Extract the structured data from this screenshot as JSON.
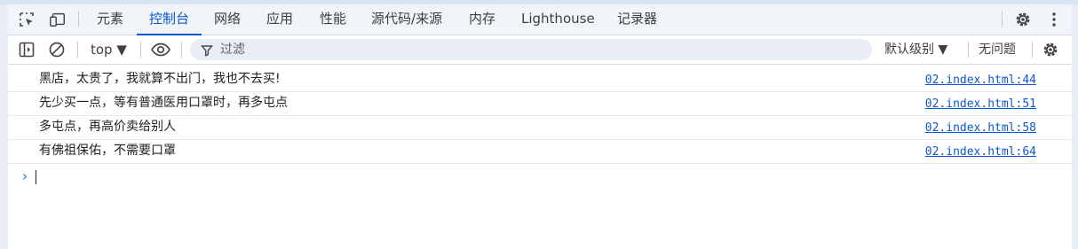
{
  "tabs": [
    {
      "label": "元素"
    },
    {
      "label": "控制台",
      "active": true
    },
    {
      "label": "网络"
    },
    {
      "label": "应用"
    },
    {
      "label": "性能"
    },
    {
      "label": "源代码/来源"
    },
    {
      "label": "内存"
    },
    {
      "label": "Lighthouse"
    },
    {
      "label": "记录器"
    }
  ],
  "toolbar": {
    "context": "top ▼",
    "filter_placeholder": "过滤",
    "levels": "默认级别 ▼",
    "issues": "无问题"
  },
  "messages": [
    {
      "text": "黑店，太贵了，我就算不出门，我也不去买!",
      "source": "02.index.html:44"
    },
    {
      "text": "先少买一点，等有普通医用口罩时，再多屯点",
      "source": "02.index.html:51"
    },
    {
      "text": "多屯点，再高价卖给别人",
      "source": "02.index.html:58"
    },
    {
      "text": "有佛祖保佑，不需要口罩",
      "source": "02.index.html:64"
    }
  ],
  "prompt": {
    "symbol": "›"
  },
  "colors": {
    "accent": "#0b57d0",
    "tabbar_bg": "#f1f4f9",
    "filter_bg": "#e9eef6"
  },
  "icons": [
    "inspect-icon",
    "device-toggle-icon",
    "settings-icon",
    "more-vert-icon",
    "sidebar-toggle-icon",
    "clear-console-icon",
    "eye-icon",
    "filter-icon",
    "console-settings-icon"
  ]
}
